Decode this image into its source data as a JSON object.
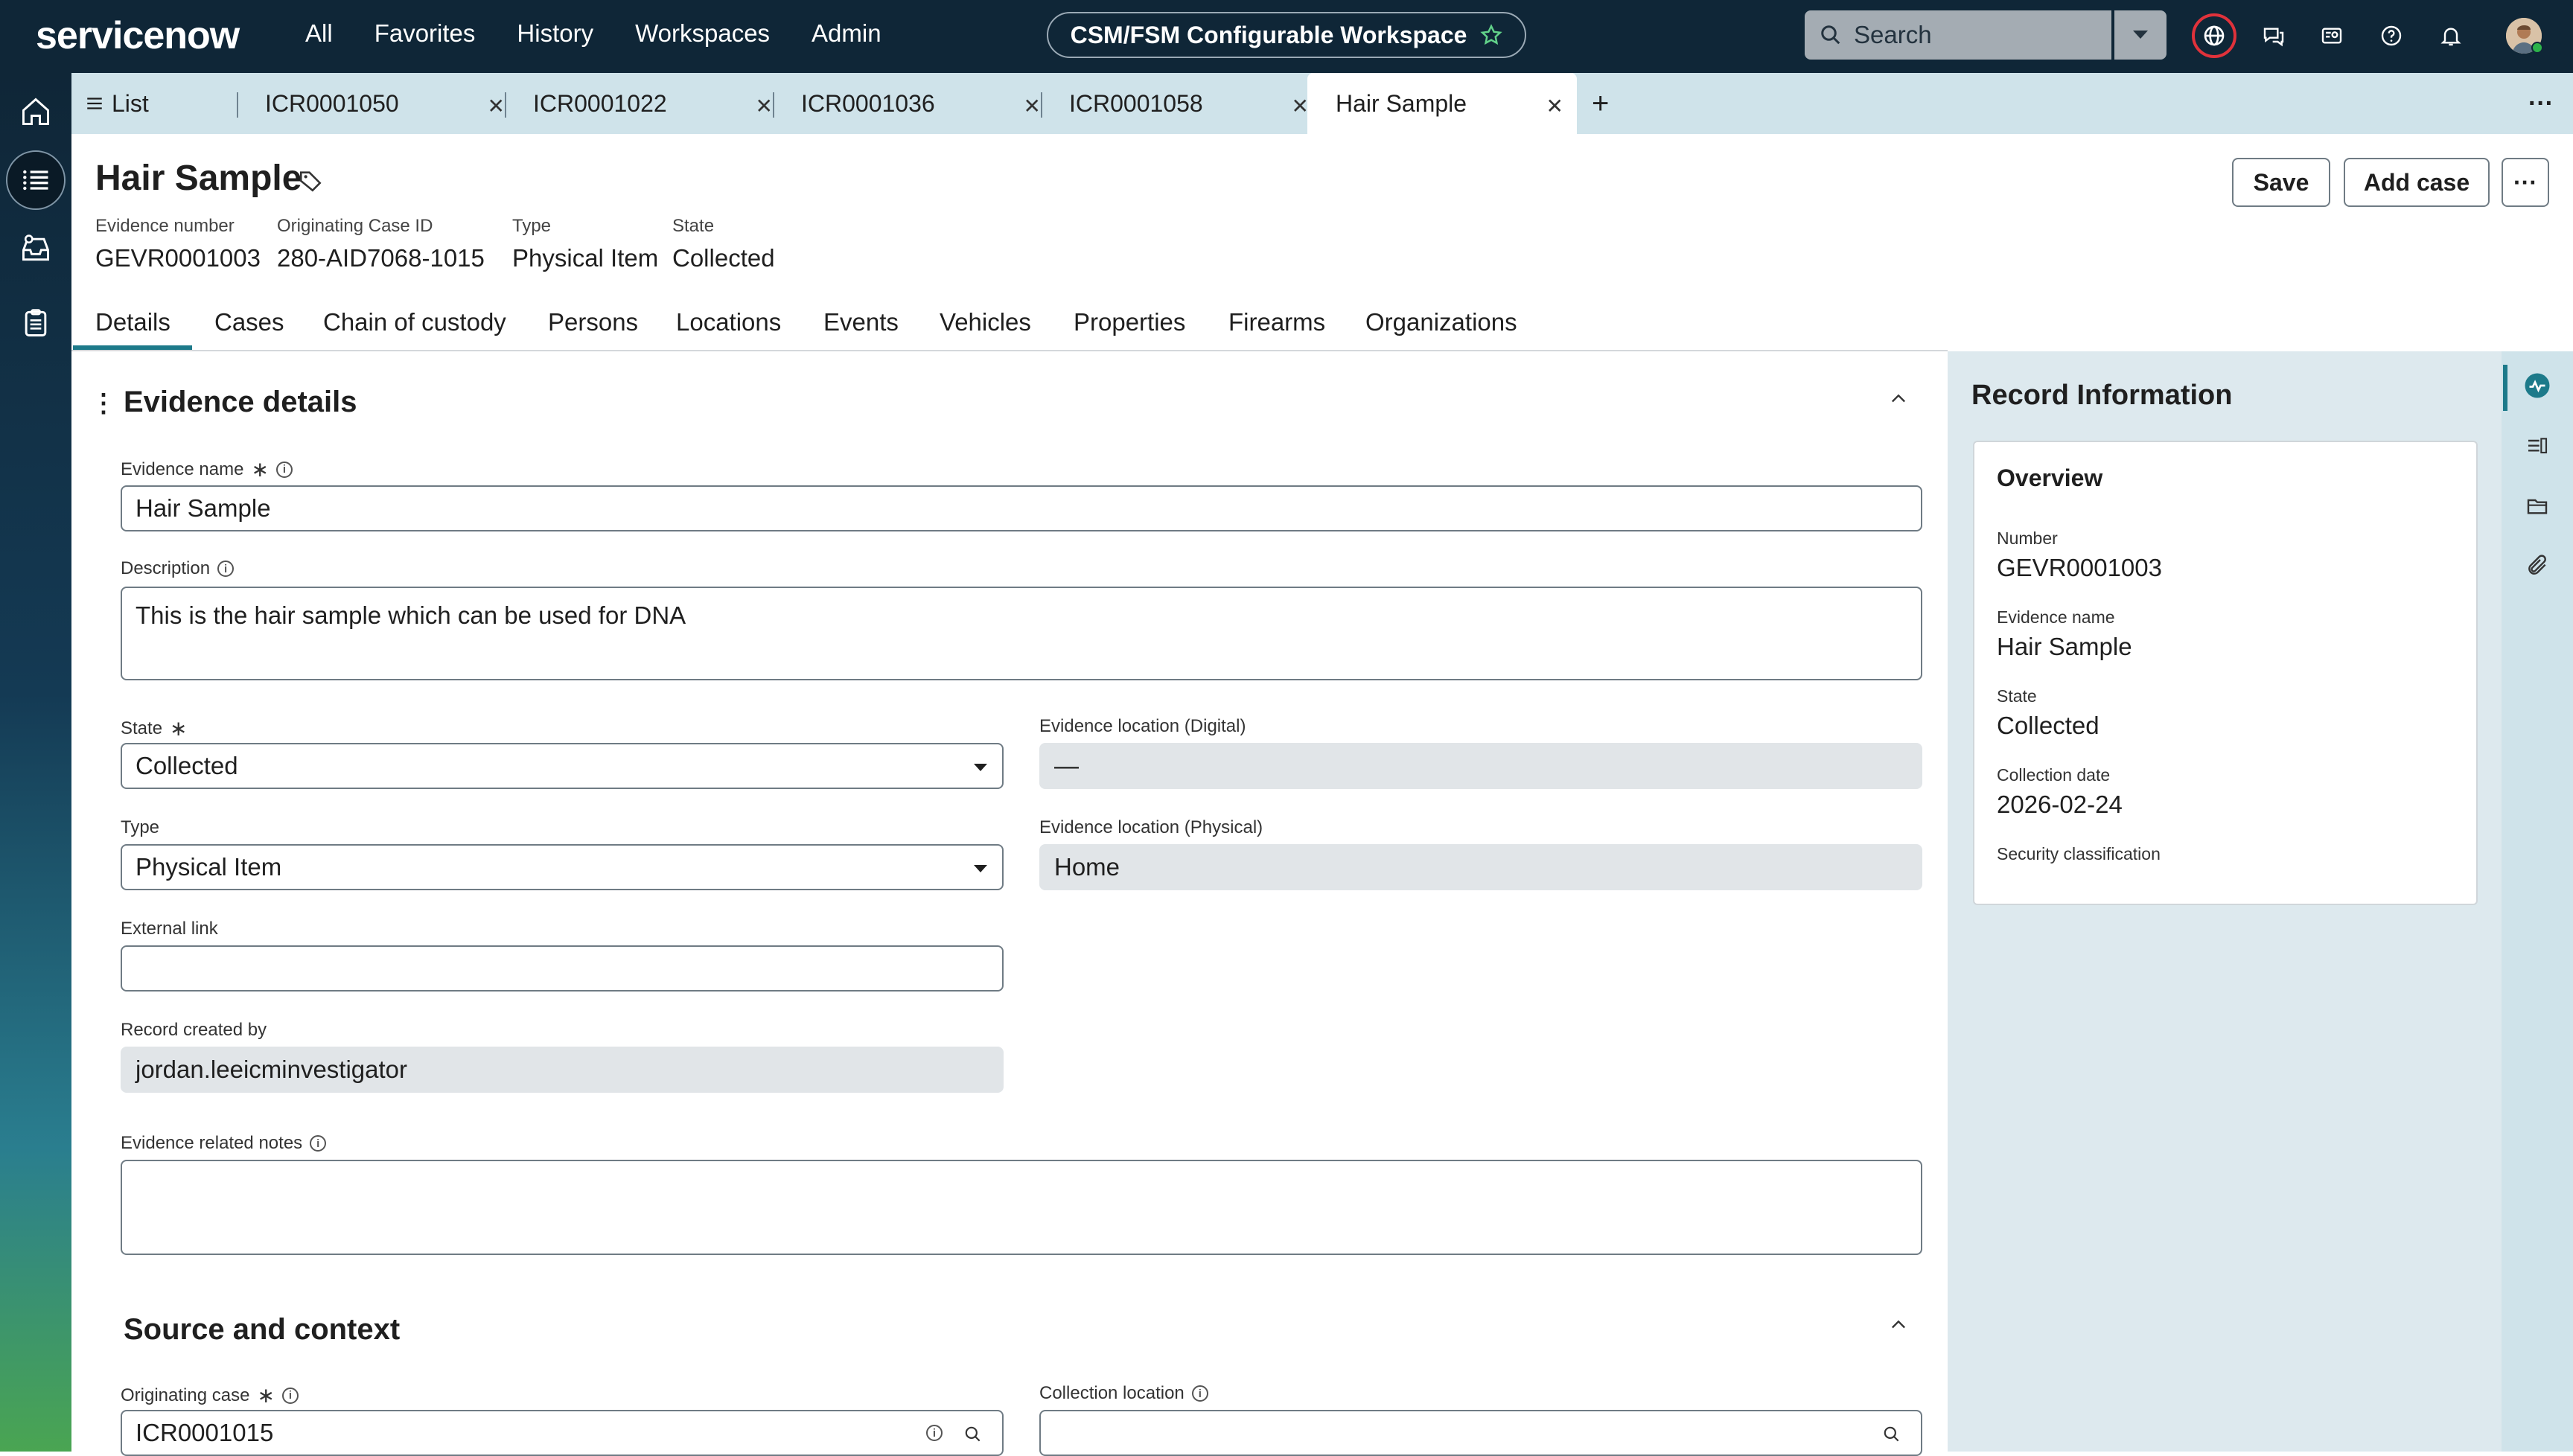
{
  "topbar": {
    "logo": "servicenow",
    "nav": [
      "All",
      "Favorites",
      "History",
      "Workspaces",
      "Admin"
    ],
    "workspace": "CSM/FSM Configurable Workspace",
    "search_placeholder": "Search"
  },
  "tabs": [
    {
      "label": "List"
    },
    {
      "label": "ICR0001050"
    },
    {
      "label": "ICR0001022"
    },
    {
      "label": "ICR0001036"
    },
    {
      "label": "ICR0001058"
    },
    {
      "label": "Hair Sample"
    }
  ],
  "record": {
    "title": "Hair Sample",
    "meta": [
      {
        "label": "Evidence number",
        "value": "GEVR0001003"
      },
      {
        "label": "Originating Case ID",
        "value": "280-AID7068-1015"
      },
      {
        "label": "Type",
        "value": "Physical Item"
      },
      {
        "label": "State",
        "value": "Collected"
      }
    ],
    "buttons": {
      "save": "Save",
      "add_case": "Add case",
      "more": "···"
    }
  },
  "subtabs": [
    "Details",
    "Cases",
    "Chain of custody",
    "Persons",
    "Locations",
    "Events",
    "Vehicles",
    "Properties",
    "Firearms",
    "Organizations"
  ],
  "form": {
    "section1": "Evidence details",
    "evidence_name": {
      "label": "Evidence name",
      "value": "Hair Sample"
    },
    "description": {
      "label": "Description",
      "value": "This is the hair sample which can be used for DNA"
    },
    "state": {
      "label": "State",
      "value": "Collected"
    },
    "type": {
      "label": "Type",
      "value": "Physical Item"
    },
    "external_link": {
      "label": "External link",
      "value": ""
    },
    "record_created_by": {
      "label": "Record created by",
      "value": "jordan.leeicminvestigator"
    },
    "evidence_location_digital": {
      "label": "Evidence location (Digital)",
      "value": "—"
    },
    "evidence_location_physical": {
      "label": "Evidence location (Physical)",
      "value": "Home"
    },
    "notes": {
      "label": "Evidence related notes",
      "value": ""
    },
    "section2": "Source and context",
    "originating_case": {
      "label": "Originating case",
      "value": "ICR0001015"
    },
    "collection_location": {
      "label": "Collection location",
      "value": ""
    }
  },
  "record_info": {
    "title": "Record Information",
    "overview": "Overview",
    "fields": [
      {
        "label": "Number",
        "value": "GEVR0001003"
      },
      {
        "label": "Evidence name",
        "value": "Hair Sample"
      },
      {
        "label": "State",
        "value": "Collected"
      },
      {
        "label": "Collection date",
        "value": "2026-02-24"
      },
      {
        "label": "Security classification",
        "value": ""
      }
    ]
  },
  "required_mark": "∗"
}
